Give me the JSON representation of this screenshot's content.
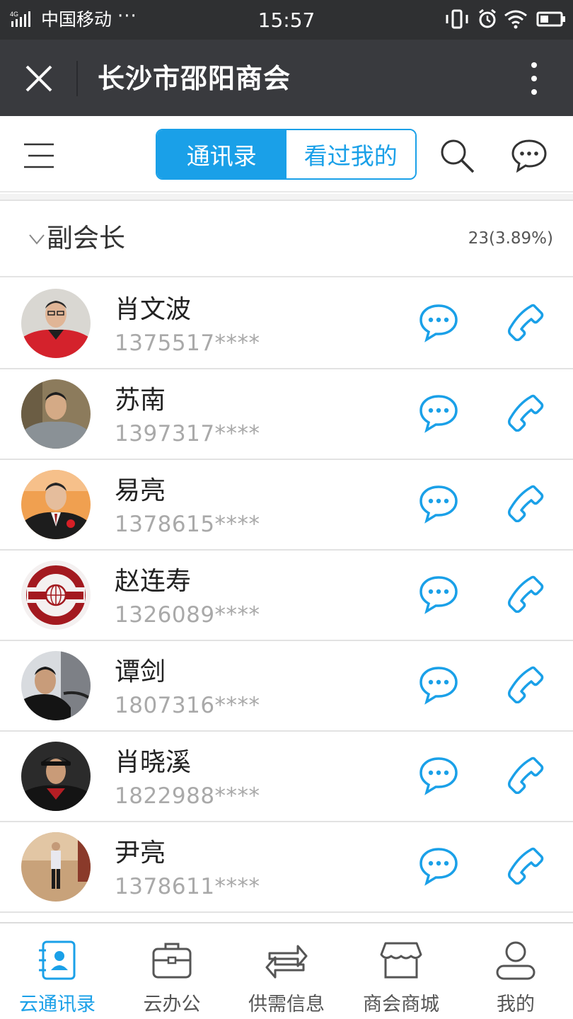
{
  "status_bar": {
    "carrier": "中国移动",
    "dots": "···",
    "time": "15:57"
  },
  "titlebar": {
    "title": "长沙市邵阳商会"
  },
  "toolbar": {
    "tabs": [
      {
        "label": "通讯录",
        "active": true
      },
      {
        "label": "看过我的",
        "active": false
      }
    ]
  },
  "group": {
    "title": "副会长",
    "count": "23(3.89%)"
  },
  "contacts": [
    {
      "name": "肖文波",
      "phone": "1375517****",
      "avatar": "photo-man-red-shirt"
    },
    {
      "name": "苏南",
      "phone": "1397317****",
      "avatar": "photo-man-grey-shirt"
    },
    {
      "name": "易亮",
      "phone": "1378615****",
      "avatar": "photo-man-suit"
    },
    {
      "name": "赵连寿",
      "phone": "1326089****",
      "avatar": "logo-globe-red"
    },
    {
      "name": "谭剑",
      "phone": "1807316****",
      "avatar": "photo-man-in-car"
    },
    {
      "name": "肖晓溪",
      "phone": "1822988****",
      "avatar": "photo-man-hat"
    },
    {
      "name": "尹亮",
      "phone": "1378611****",
      "avatar": "photo-man-standing"
    }
  ],
  "bottom_nav": [
    {
      "label": "云通讯录",
      "icon": "contacts-card-icon",
      "active": true
    },
    {
      "label": "云办公",
      "icon": "briefcase-icon",
      "active": false
    },
    {
      "label": "供需信息",
      "icon": "exchange-arrows-icon",
      "active": false
    },
    {
      "label": "商会商城",
      "icon": "store-icon",
      "active": false
    },
    {
      "label": "我的",
      "icon": "person-icon",
      "active": false
    }
  ],
  "colors": {
    "accent": "#1aa0e8",
    "statusbar_bg": "#2f3032",
    "titlebar_bg": "#393a3e",
    "phone_text": "#a9a9a9"
  }
}
